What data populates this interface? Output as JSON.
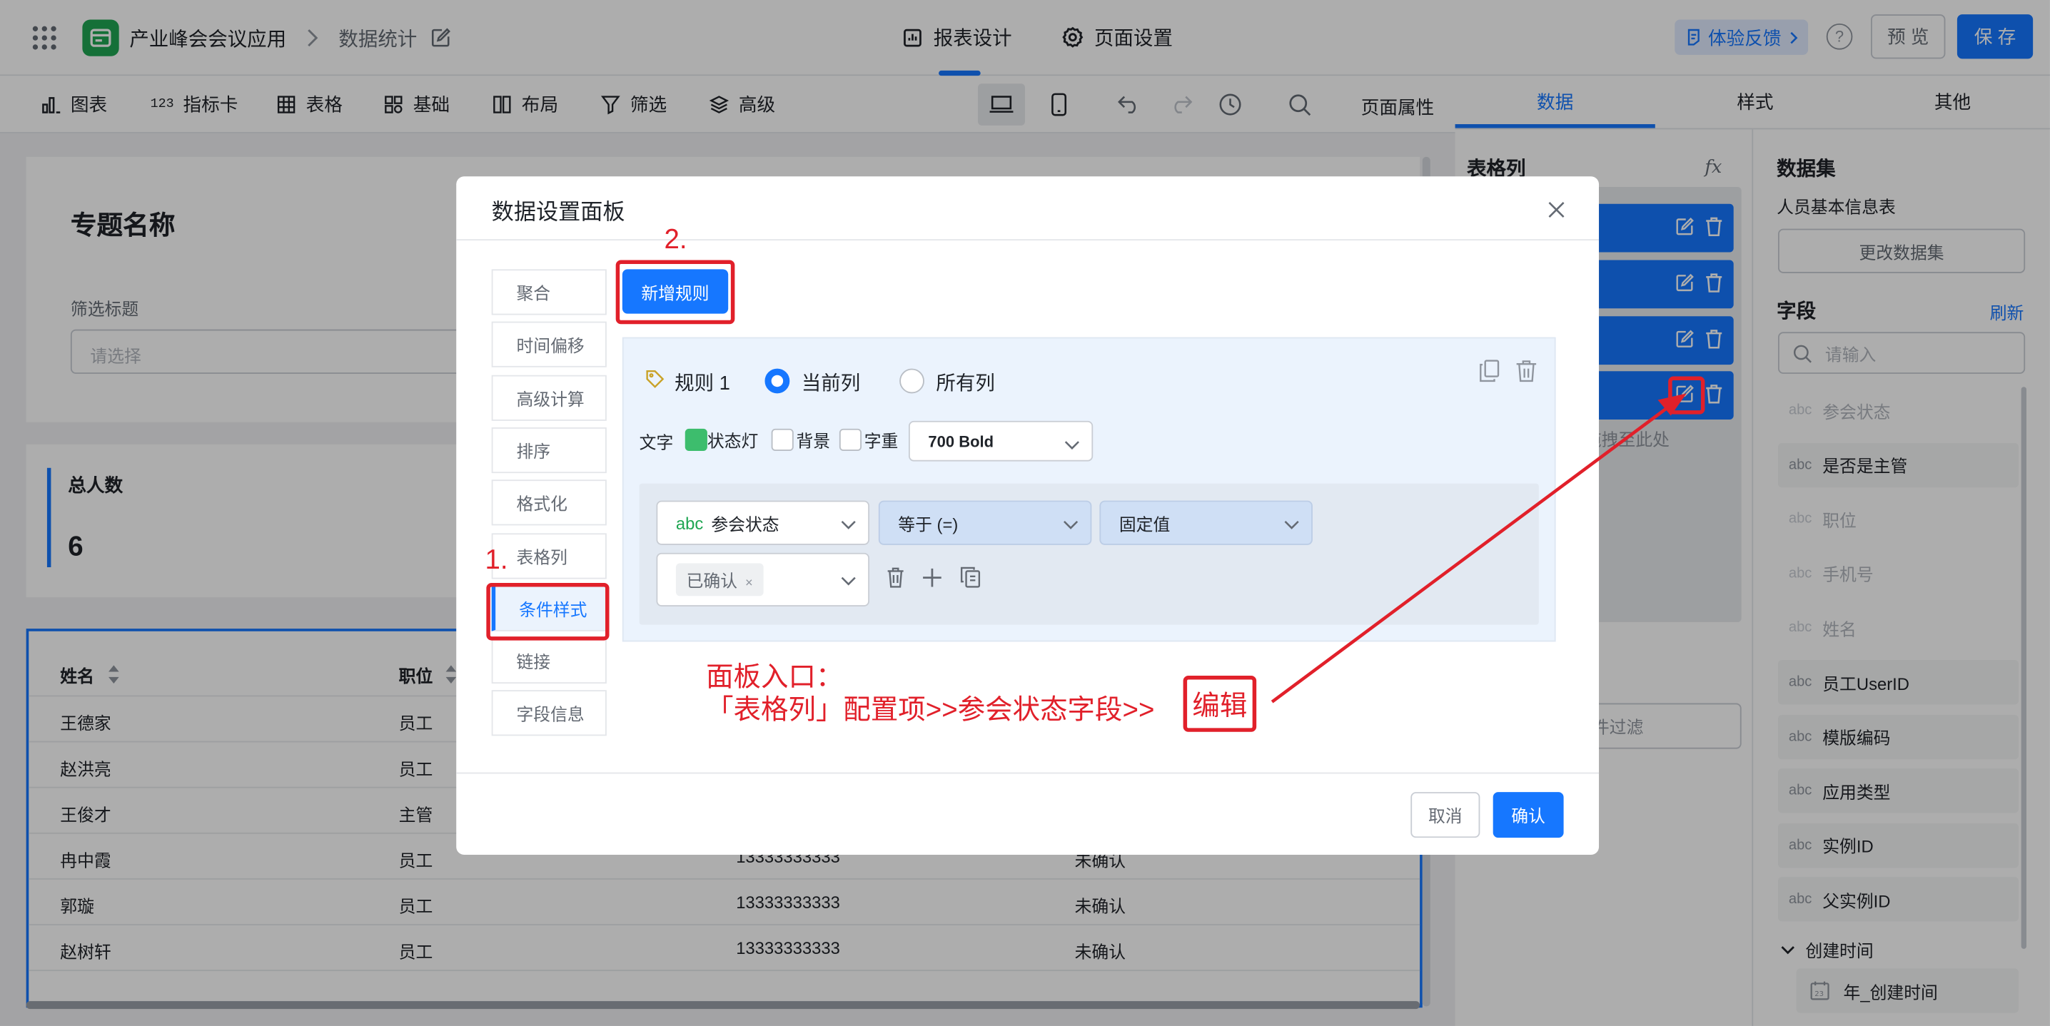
{
  "app": {
    "name": "产业峰会会议应用",
    "page": "数据统计"
  },
  "header": {
    "tabs": [
      "报表设计",
      "页面设置"
    ],
    "feedback": "体验反馈",
    "preview": "预 览",
    "save": "保 存"
  },
  "toolbar": {
    "items": [
      "图表",
      "指标卡",
      "表格",
      "基础",
      "布局",
      "筛选",
      "高级"
    ],
    "page_props": "页面属性"
  },
  "canvas": {
    "topic_title": "专题名称",
    "filter_label": "筛选标题",
    "filter_placeholder": "请选择",
    "kpi": {
      "label": "总人数",
      "value": "6"
    },
    "table": {
      "headers": [
        "姓名",
        "职位"
      ],
      "rows": [
        {
          "name": "王德家",
          "role": "员工",
          "phone": "",
          "status": ""
        },
        {
          "name": "赵洪亮",
          "role": "员工",
          "phone": "",
          "status": ""
        },
        {
          "name": "王俊才",
          "role": "主管",
          "phone": "",
          "status": ""
        },
        {
          "name": "冉中霞",
          "role": "员工",
          "phone": "13333333333",
          "status": "未确认"
        },
        {
          "name": "郭璇",
          "role": "员工",
          "phone": "13333333333",
          "status": "未确认"
        },
        {
          "name": "赵树轩",
          "role": "员工",
          "phone": "13333333333",
          "status": "未确认"
        }
      ]
    }
  },
  "right_panel": {
    "tabs": [
      "数据",
      "样式",
      "其他"
    ],
    "table_cols_title": "表格列",
    "fx": "fx",
    "drag_hint": "拖拽至此处",
    "filter_hint": "条件过滤",
    "dataset_title": "数据集",
    "dataset_name": "人员基本信息表",
    "change_dataset": "更改数据集",
    "fields_title": "字段",
    "refresh": "刷新",
    "search_placeholder": "请输入",
    "fields": [
      {
        "type": "abc",
        "name": "参会状态",
        "disabled": true
      },
      {
        "type": "abc",
        "name": "是否是主管",
        "disabled": false
      },
      {
        "type": "abc",
        "name": "职位",
        "disabled": true
      },
      {
        "type": "abc",
        "name": "手机号",
        "disabled": true
      },
      {
        "type": "abc",
        "name": "姓名",
        "disabled": true
      },
      {
        "type": "abc",
        "name": "员工UserID",
        "disabled": false
      },
      {
        "type": "abc",
        "name": "模版编码",
        "disabled": false
      },
      {
        "type": "abc",
        "name": "应用类型",
        "disabled": false
      },
      {
        "type": "abc",
        "name": "实例ID",
        "disabled": false
      },
      {
        "type": "abc",
        "name": "父实例ID",
        "disabled": false
      }
    ],
    "group": "创建时间",
    "group_field": "年_创建时间"
  },
  "modal": {
    "title": "数据设置面板",
    "sidebar": [
      "聚合",
      "时间偏移",
      "高级计算",
      "排序",
      "格式化",
      "表格列",
      "条件样式",
      "链接",
      "字段信息"
    ],
    "active_index": 6,
    "add_rule": "新增规则",
    "rule": {
      "name": "规则 1",
      "scope_options": [
        "当前列",
        "所有列"
      ],
      "scope_selected": "当前列",
      "text_label": "文字",
      "checks": [
        {
          "label": "状态灯",
          "checked": true
        },
        {
          "label": "背景",
          "checked": false
        },
        {
          "label": "字重",
          "checked": false
        }
      ],
      "weight": "700 Bold",
      "field_type": "abc",
      "field": "参会状态",
      "operator": "等于 (=)",
      "value_mode": "固定值",
      "value_tag": "已确认"
    },
    "cancel": "取消",
    "confirm": "确认"
  },
  "annotations": {
    "step1": "1.",
    "step2": "2.",
    "line1": "面板入口：",
    "line2": "「表格列」配置项>>参会状态字段>>",
    "line2_box": "编辑"
  },
  "colors": {
    "primary": "#1677ff",
    "brand_green": "#1fa653",
    "annotation_red": "#e1202a",
    "state_green": "#3dbd6d"
  }
}
